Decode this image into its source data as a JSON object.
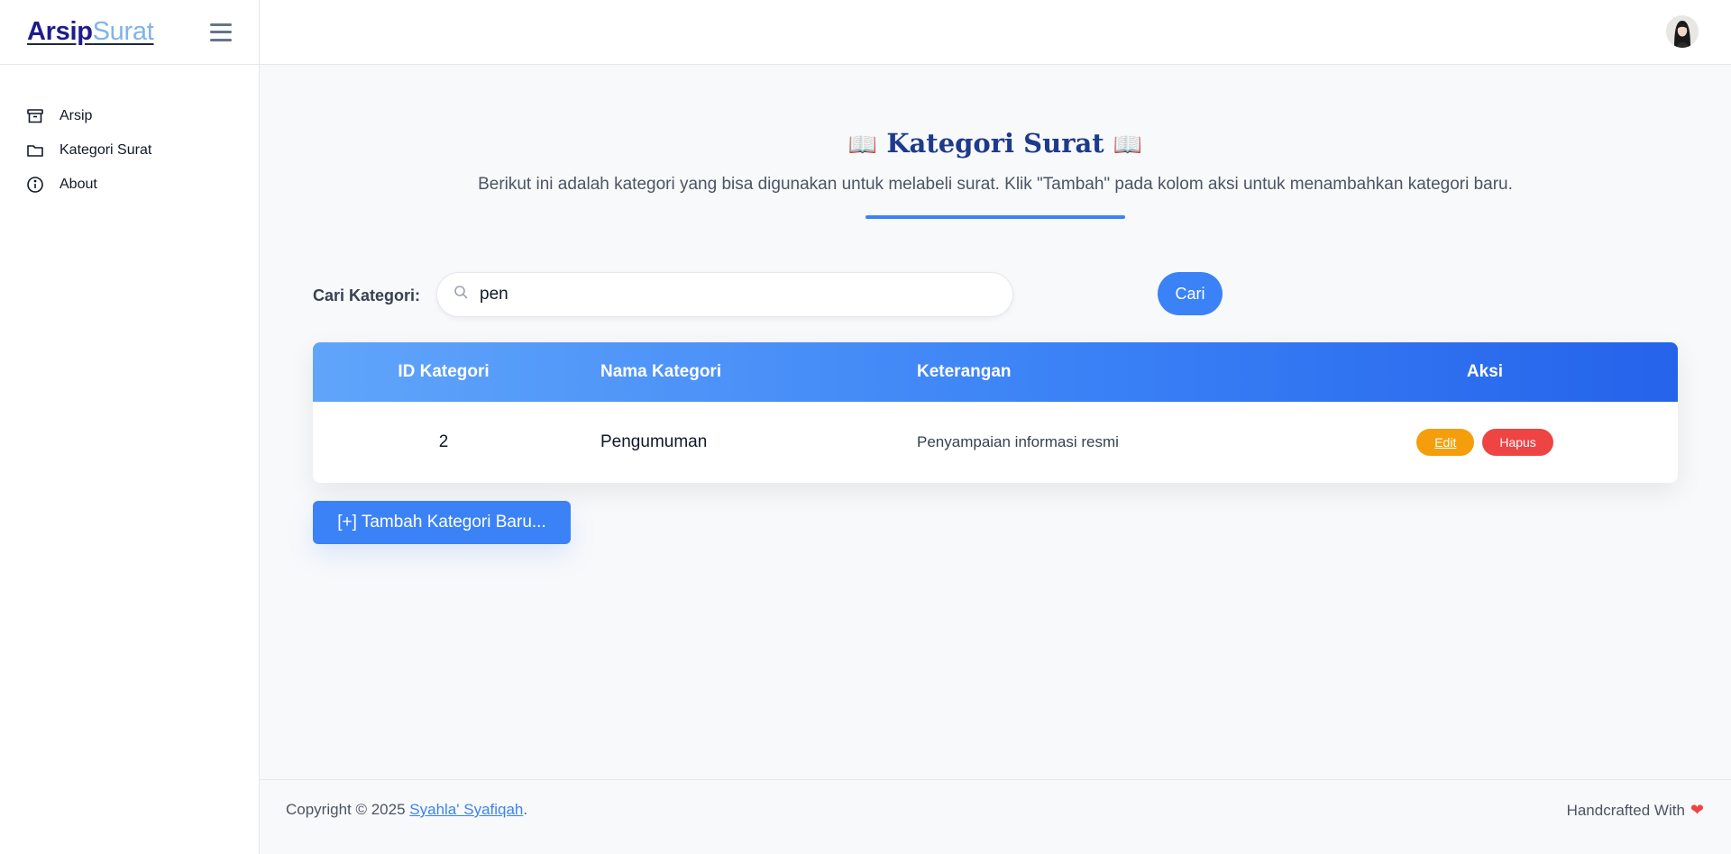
{
  "brand": {
    "part1": "Arsip",
    "part2": "Surat"
  },
  "sidebar": {
    "items": [
      {
        "label": "Arsip",
        "icon": "archive-icon"
      },
      {
        "label": "Kategori Surat",
        "icon": "folder-icon"
      },
      {
        "label": "About",
        "icon": "info-icon"
      }
    ]
  },
  "header": {
    "title": "Kategori Surat",
    "book_emoji": "📖"
  },
  "subtitle": "Berikut ini adalah kategori yang bisa digunakan untuk melabeli surat. Klik \"Tambah\" pada kolom aksi untuk menambahkan kategori baru.",
  "search": {
    "label": "Cari Kategori:",
    "value": "pen",
    "button": "Cari"
  },
  "table": {
    "headers": [
      "ID Kategori",
      "Nama Kategori",
      "Keterangan",
      "Aksi"
    ],
    "rows": [
      {
        "id": "2",
        "nama": "Pengumuman",
        "keterangan": "Penyampaian informasi resmi",
        "edit": "Edit",
        "hapus": "Hapus"
      }
    ]
  },
  "add_button": "[+] Tambah Kategori Baru...",
  "footer": {
    "copyright": "Copyright © 2025 ",
    "author": "Syahla' Syafiqah",
    "period": ".",
    "handcrafted": "Handcrafted With",
    "heart": "❤"
  },
  "colors": {
    "accent": "#3b82f6",
    "brand_dark": "#1e1b8f",
    "brand_light": "#7fb3ea",
    "edit": "#f59e0b",
    "hapus": "#ef4444",
    "heading": "#1e3a8a"
  }
}
